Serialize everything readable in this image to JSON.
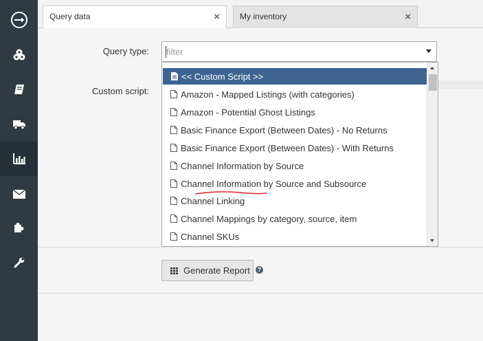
{
  "sidebar": {
    "items": [
      {
        "icon": "logo-icon"
      },
      {
        "icon": "dashboard-icon"
      },
      {
        "icon": "book-icon"
      },
      {
        "icon": "truck-icon"
      },
      {
        "icon": "reports-icon",
        "active": true
      },
      {
        "icon": "envelope-icon"
      },
      {
        "icon": "puzzle-icon"
      },
      {
        "icon": "wrench-icon"
      }
    ]
  },
  "tabs": [
    {
      "label": "Query data",
      "active": true
    },
    {
      "label": "My inventory",
      "active": false
    }
  ],
  "tab_close_glyph": "×",
  "form": {
    "query_type_label": "Query type:",
    "custom_script_label": "Custom script:",
    "filter_placeholder": "filter"
  },
  "dropdown": {
    "options": [
      "<< Custom Script >>",
      "Amazon - Mapped Listings (with categories)",
      "Amazon - Potential Ghost Listings",
      "Basic Finance Export (Between Dates) - No Returns",
      "Basic Finance Export (Between Dates) - With Returns",
      "Channel Information by Source",
      "Channel Information by Source and Subsource",
      "Channel Linking",
      "Channel Mappings by category, source, item",
      "Channel SKUs"
    ],
    "highlighted_index": 0
  },
  "generate_button_label": "Generate Report",
  "help_glyph": "?",
  "colors": {
    "sidebar": "#2f3a43",
    "highlight": "#3e6591",
    "annotation": "#d9262b"
  }
}
